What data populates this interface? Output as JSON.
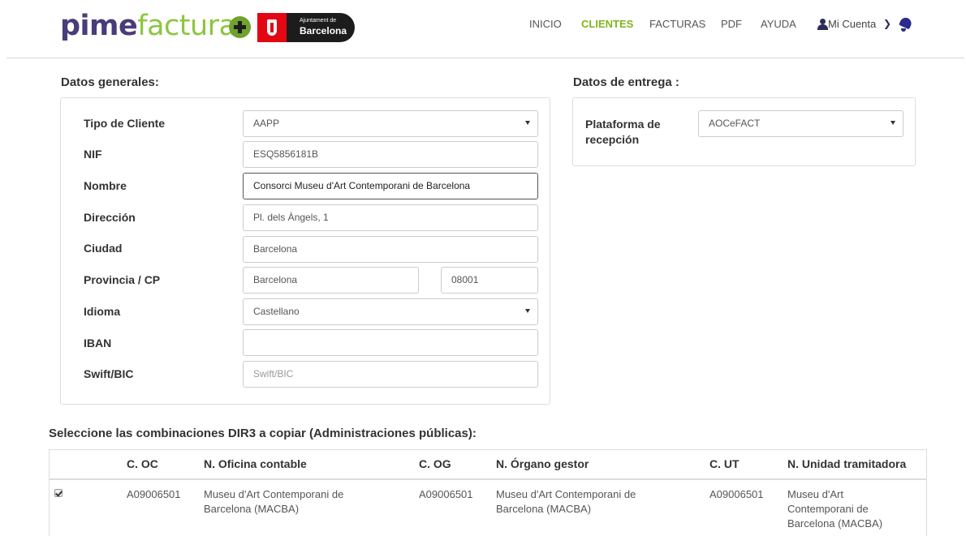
{
  "header": {
    "logo_part1": "pime",
    "logo_part2": "factura",
    "partner_small": "Ajuntament de",
    "partner_big": "Barcelona",
    "nav": [
      "INICIO",
      "CLIENTES",
      "FACTURAS",
      "PDF",
      "AYUDA"
    ],
    "active_nav": "CLIENTES",
    "account_label": "Mi Cuenta"
  },
  "general": {
    "title": "Datos generales:",
    "tipo_label": "Tipo de Cliente",
    "tipo_value": "AAPP",
    "nif_label": "NIF",
    "nif_value": "ESQ5856181B",
    "nombre_label": "Nombre",
    "nombre_value": "Consorci Museu d'Art Contemporani de Barcelona",
    "direccion_label": "Dirección",
    "direccion_value": "Pl. dels Àngels, 1",
    "ciudad_label": "Ciudad",
    "ciudad_value": "Barcelona",
    "provincia_label": "Provincia / CP",
    "provincia_value": "Barcelona",
    "cp_value": "08001",
    "idioma_label": "Idioma",
    "idioma_value": "Castellano",
    "iban_label": "IBAN",
    "iban_value": "",
    "swift_label": "Swift/BIC",
    "swift_placeholder": "Swift/BIC"
  },
  "entrega": {
    "title": "Datos de entrega :",
    "plataforma_label": "Plataforma de recepción",
    "plataforma_value": "AOCeFACT"
  },
  "dir3": {
    "title": "Seleccione las combinaciones DIR3 a copiar (Administraciones públicas):",
    "columns": [
      "C. OC",
      "N. Oficina contable",
      "C. OG",
      "N. Órgano gestor",
      "C. UT",
      "N. Unidad tramitadora"
    ],
    "rows": [
      {
        "checked": true,
        "c_oc": "A09006501",
        "n_oc": "Museu d'Art Contemporani de Barcelona (MACBA)",
        "c_og": "A09006501",
        "n_og": "Museu d'Art Contemporani de Barcelona (MACBA)",
        "c_ut": "A09006501",
        "n_ut": "Museu d'Art Contemporani de Barcelona (MACBA)"
      }
    ]
  }
}
